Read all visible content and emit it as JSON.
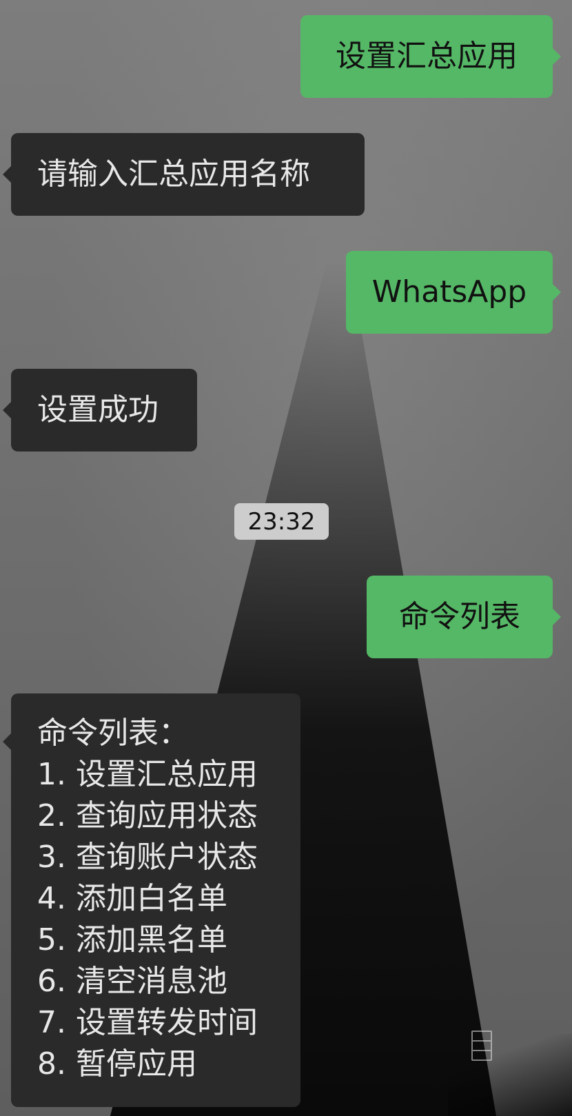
{
  "messages": {
    "m1": "设置汇总应用",
    "m2": "请输入汇总应用名称",
    "m3": "WhatsApp",
    "m4": "设置成功",
    "m5": "命令列表",
    "m6": {
      "title": "命令列表：",
      "lines": [
        "1. 设置汇总应用",
        "2. 查询应用状态",
        "3. 查询账户状态",
        "4. 添加白名单",
        "5. 添加黑名单",
        "6. 清空消息池",
        "7. 设置转发时间",
        "8. 暂停应用"
      ]
    }
  },
  "timestamp": "23:32",
  "colors": {
    "outgoing_bubble": "#55b866",
    "incoming_bubble": "#2a2a2a"
  }
}
